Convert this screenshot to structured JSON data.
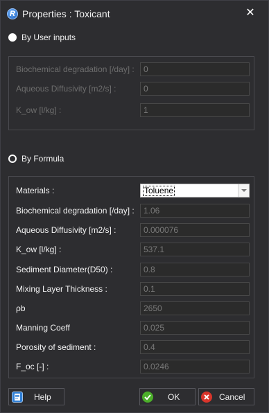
{
  "window": {
    "title": "Properties : Toxicant"
  },
  "user_inputs": {
    "label": "By User inputs",
    "rows": [
      {
        "label": "Biochemical degradation [/day] :",
        "value": "0"
      },
      {
        "label": "Aqueous Diffusivity [m2/s] :",
        "value": "0"
      },
      {
        "label": "K_ow [l/kg] :",
        "value": "1"
      }
    ]
  },
  "formula": {
    "label": "By Formula",
    "materials_label": "Materials :",
    "materials_value": "Toluene",
    "rows": [
      {
        "label": "Biochemical degradation [/day] :",
        "value": "1.06"
      },
      {
        "label": "Aqueous Diffusivity [m2/s] :",
        "value": "0.000076"
      },
      {
        "label": "K_ow [l/kg] :",
        "value": "537.1"
      },
      {
        "label": "Sediment Diameter(D50) :",
        "value": "0.8"
      },
      {
        "label": "Mixing Layer Thickness :",
        "value": "0.1"
      },
      {
        "label": "ρb",
        "value": "2650"
      },
      {
        "label": "Manning Coeff",
        "value": "0.025"
      },
      {
        "label": "Porosity of sediment :",
        "value": "0.4"
      },
      {
        "label": "F_oc [-] :",
        "value": "0.0246"
      }
    ]
  },
  "buttons": {
    "help": "Help",
    "ok": "OK",
    "cancel": "Cancel"
  },
  "icons": {
    "app": "app-r-icon",
    "close": "close-icon",
    "help": "help-book-icon",
    "ok": "check-icon",
    "cancel": "cancel-icon"
  },
  "colors": {
    "ok_green": "#4caf2a",
    "cancel_red": "#d9352b",
    "help_blue": "#2f7fd6"
  }
}
